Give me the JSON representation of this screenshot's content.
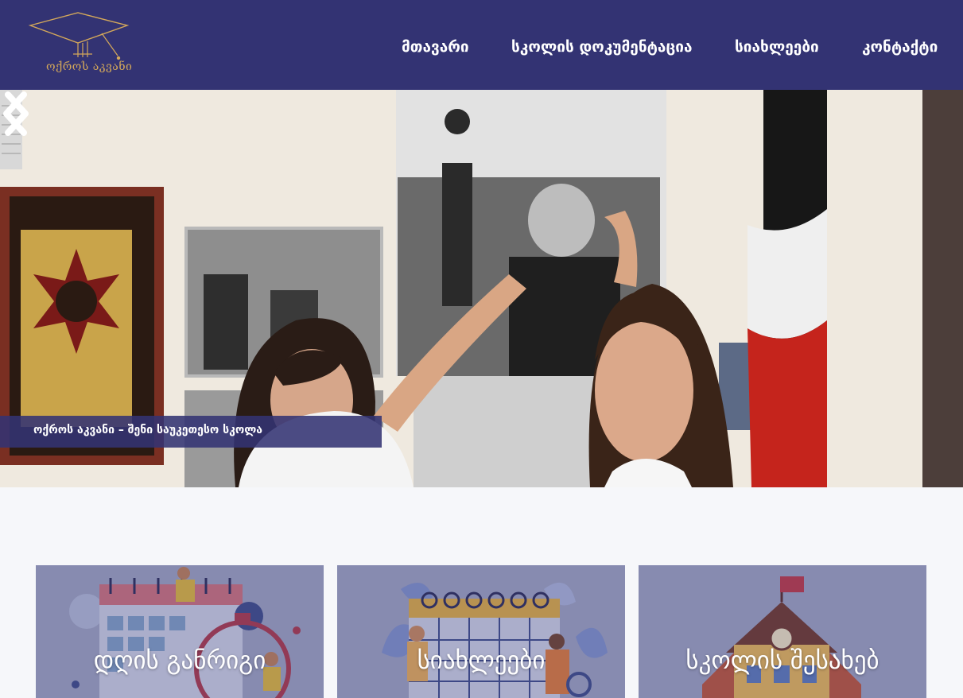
{
  "header": {
    "logo_text": "ოქროს აკვანი",
    "nav": [
      "მთავარი",
      "სკოლის დოკუმენტაცია",
      "სიახლეები",
      "კონტაქტი"
    ]
  },
  "hero": {
    "caption": "ოქროს აკვანი – შენი საუკეთესო სკოლა",
    "prev_icon": "chevron-left-icon",
    "next_icon": "chevron-right-icon"
  },
  "cards": [
    {
      "title": "დღის განრიგი",
      "icon": "calendar-clock-illustration"
    },
    {
      "title": "სიახლეები",
      "icon": "calendar-people-illustration"
    },
    {
      "title": "სკოლის შესახებ",
      "icon": "school-building-illustration"
    }
  ],
  "colors": {
    "header_bg": "#333373",
    "logo_gold": "#d4a85a",
    "page_bg": "#f6f7fa",
    "card_bg": "#9a9fbe",
    "caption_bg": "#333373"
  }
}
